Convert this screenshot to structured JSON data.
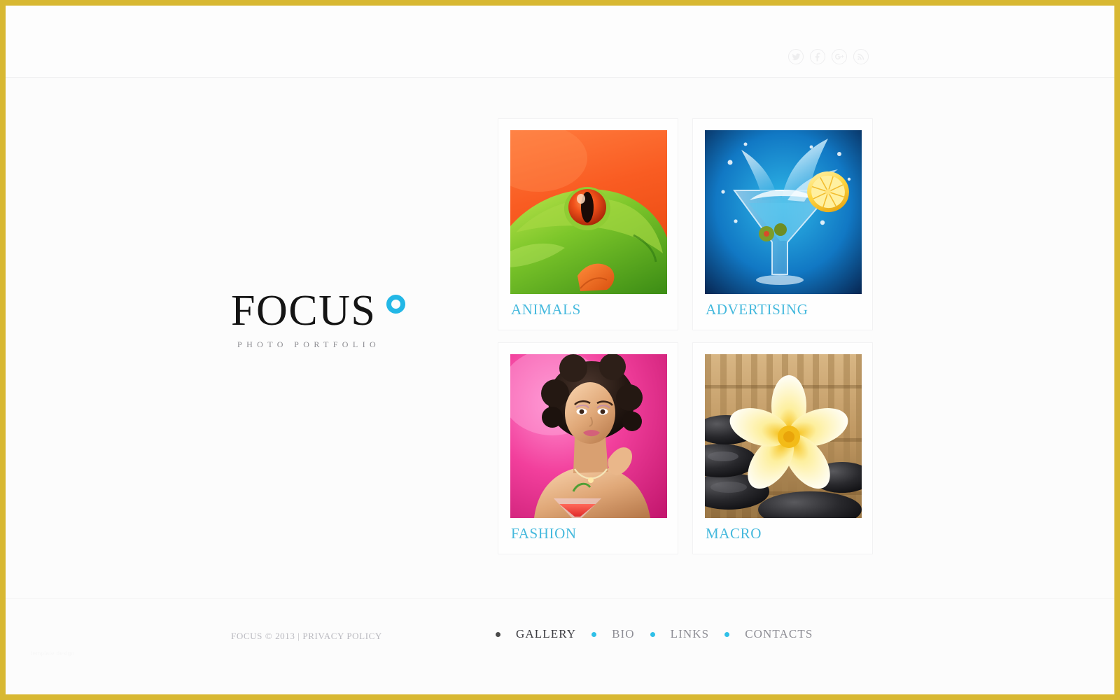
{
  "site": {
    "logo_text": "FOCUS",
    "logo_tagline": "PHOTO PORTFOLIO",
    "accent_color": "#22b7e6",
    "caption_color": "#45b9dd",
    "border_color": "#d8b832",
    "background_color": "#fcfcfc"
  },
  "header": {
    "social": [
      {
        "name": "twitter-icon",
        "label": "Twitter"
      },
      {
        "name": "facebook-icon",
        "label": "Facebook"
      },
      {
        "name": "google-plus-icon",
        "label": "Google Plus"
      },
      {
        "name": "rss-icon",
        "label": "RSS"
      }
    ]
  },
  "gallery": {
    "items": [
      {
        "caption": "ANIMALS",
        "alt": "Red-eyed tree frog on orange background"
      },
      {
        "caption": "ADVERTISING",
        "alt": "Lemon slice splashing into a cocktail glass"
      },
      {
        "caption": "FASHION",
        "alt": "Woman with afro hair on pink background"
      },
      {
        "caption": "MACRO",
        "alt": "Yellow frangipani flower on black spa stones"
      }
    ]
  },
  "footer": {
    "copyright_brand": "FOCUS",
    "copyright_years": "© 2013",
    "copyright_separator": "|",
    "privacy_label": "PRIVACY POLICY",
    "copyright_full": "FOCUS © 2013 | PRIVACY POLICY",
    "nav": [
      {
        "label": "GALLERY",
        "active": true
      },
      {
        "label": "BIO",
        "active": false
      },
      {
        "label": "LINKS",
        "active": false
      },
      {
        "label": "CONTACTS",
        "active": false
      }
    ],
    "watermark": "template design"
  }
}
